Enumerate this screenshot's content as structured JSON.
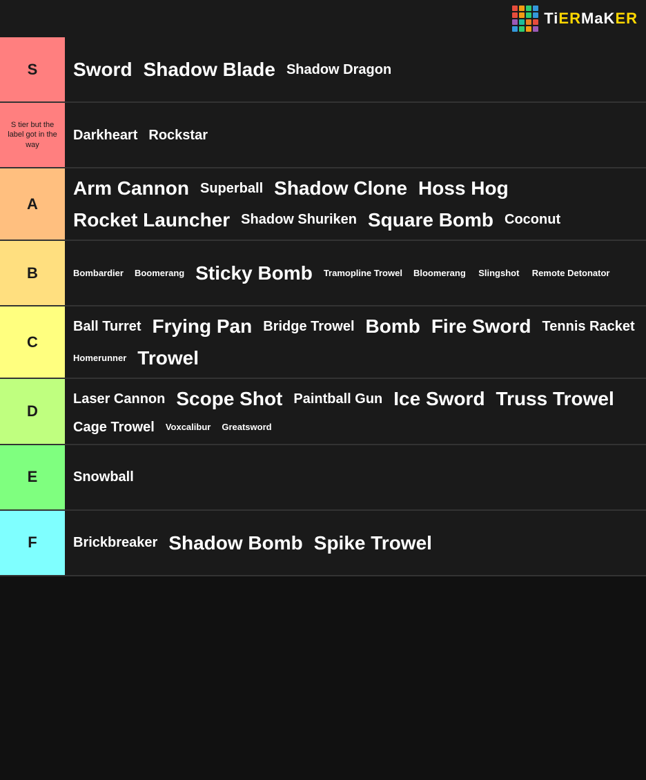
{
  "logo": {
    "text": "TiERMaKER",
    "dots": [
      "#e74c3c",
      "#f39c12",
      "#2ecc71",
      "#3498db",
      "#e74c3c",
      "#f39c12",
      "#2ecc71",
      "#3498db",
      "#9b59b6",
      "#1abc9c",
      "#e67e22",
      "#e74c3c",
      "#3498db",
      "#2ecc71",
      "#f39c12",
      "#9b59b6"
    ]
  },
  "tiers": [
    {
      "id": "s",
      "label": "S",
      "labelSmall": false,
      "color": "s-color",
      "items": [
        {
          "text": "Sword",
          "size": "large"
        },
        {
          "text": "Shadow Blade",
          "size": "large"
        },
        {
          "text": "Shadow Dragon",
          "size": "medium"
        }
      ]
    },
    {
      "id": "s-note",
      "label": "S tier but the label got in the way",
      "labelSmall": true,
      "color": "s-note-color",
      "items": [
        {
          "text": "Darkheart",
          "size": "medium"
        },
        {
          "text": "Rockstar",
          "size": "medium"
        }
      ]
    },
    {
      "id": "a",
      "label": "A",
      "labelSmall": false,
      "color": "a-color",
      "items": [
        {
          "text": "Arm Cannon",
          "size": "large"
        },
        {
          "text": "Superball",
          "size": "medium"
        },
        {
          "text": "Shadow Clone",
          "size": "large"
        },
        {
          "text": "Hoss Hog",
          "size": "large"
        },
        {
          "text": "Rocket Launcher",
          "size": "large"
        },
        {
          "text": "Shadow Shuriken",
          "size": "medium"
        },
        {
          "text": "Square Bomb",
          "size": "large"
        },
        {
          "text": "Coconut",
          "size": "medium"
        }
      ]
    },
    {
      "id": "b",
      "label": "B",
      "labelSmall": false,
      "color": "b-color",
      "items": [
        {
          "text": "Bombardier",
          "size": "small"
        },
        {
          "text": "Boomerang",
          "size": "small"
        },
        {
          "text": "Sticky Bomb",
          "size": "large"
        },
        {
          "text": "Tramopline Trowel",
          "size": "small"
        },
        {
          "text": "Bloomerang",
          "size": "small"
        },
        {
          "text": "Slingshot",
          "size": "small"
        },
        {
          "text": "Remote Detonator",
          "size": "small"
        }
      ]
    },
    {
      "id": "c",
      "label": "C",
      "labelSmall": false,
      "color": "c-color",
      "items": [
        {
          "text": "Ball Turret",
          "size": "medium"
        },
        {
          "text": "Frying Pan",
          "size": "large"
        },
        {
          "text": "Bridge Trowel",
          "size": "medium"
        },
        {
          "text": "Bomb",
          "size": "large"
        },
        {
          "text": "Fire Sword",
          "size": "large"
        },
        {
          "text": "Tennis Racket",
          "size": "medium"
        },
        {
          "text": "Homerunner",
          "size": "small"
        },
        {
          "text": "Trowel",
          "size": "large"
        }
      ]
    },
    {
      "id": "d",
      "label": "D",
      "labelSmall": false,
      "color": "d-color",
      "items": [
        {
          "text": "Laser Cannon",
          "size": "medium"
        },
        {
          "text": "Scope Shot",
          "size": "large"
        },
        {
          "text": "Paintball Gun",
          "size": "medium"
        },
        {
          "text": "Ice Sword",
          "size": "large"
        },
        {
          "text": "Truss Trowel",
          "size": "large"
        },
        {
          "text": "Cage Trowel",
          "size": "medium"
        },
        {
          "text": "Voxcalibur",
          "size": "small"
        },
        {
          "text": "Greatsword",
          "size": "small"
        }
      ]
    },
    {
      "id": "e",
      "label": "E",
      "labelSmall": false,
      "color": "e-color",
      "items": [
        {
          "text": "Snowball",
          "size": "medium"
        }
      ]
    },
    {
      "id": "f",
      "label": "F",
      "labelSmall": false,
      "color": "f-color",
      "items": [
        {
          "text": "Brickbreaker",
          "size": "medium"
        },
        {
          "text": "Shadow Bomb",
          "size": "large"
        },
        {
          "text": "Spike Trowel",
          "size": "large"
        }
      ]
    }
  ]
}
